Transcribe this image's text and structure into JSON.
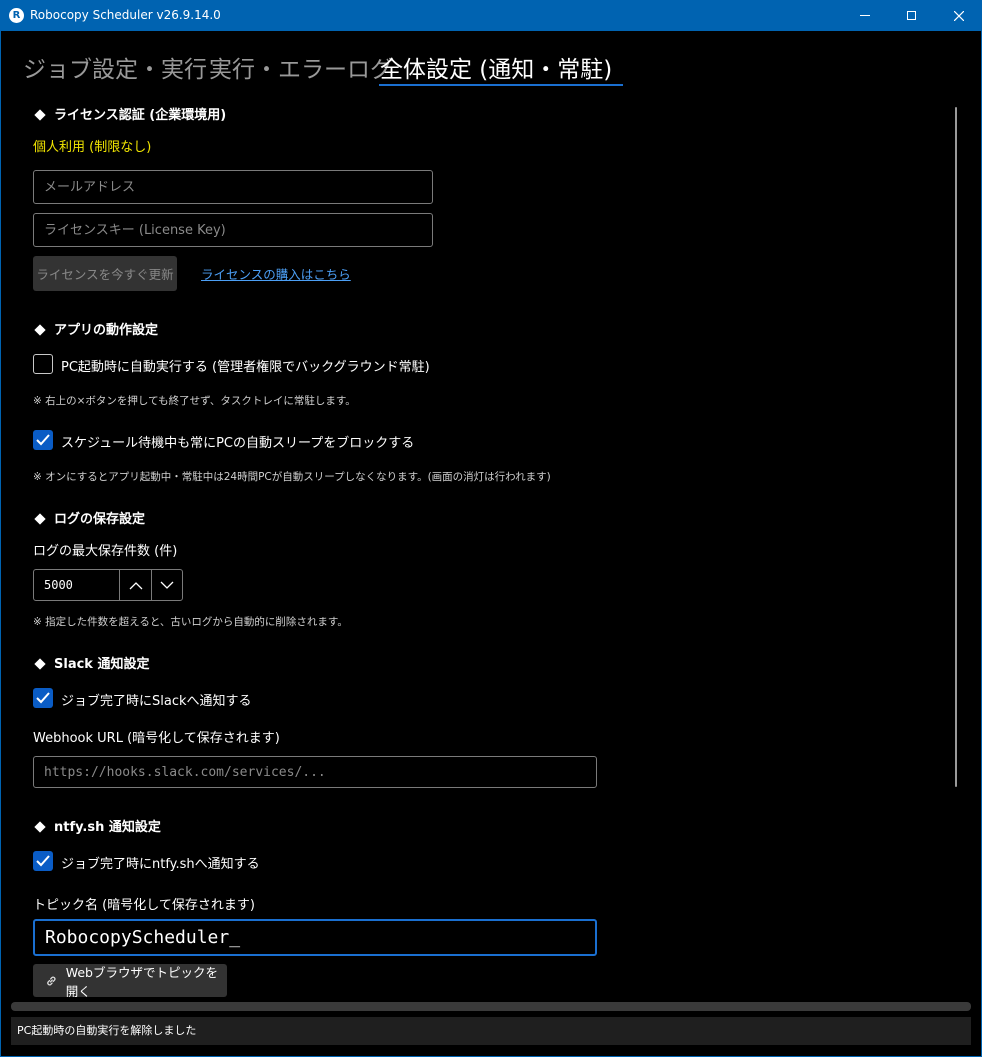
{
  "window": {
    "title": "Robocopy Scheduler v26.9.14.0"
  },
  "tabs": [
    {
      "label": "ジョブ設定・実行"
    },
    {
      "label": "実行・エラーログ"
    },
    {
      "label": "全体設定 (通知・常駐)"
    }
  ],
  "license": {
    "heading": "ライセンス認証 (企業環境用)",
    "status": "個人利用 (制限なし)",
    "email_placeholder": "メールアドレス",
    "key_placeholder": "ライセンスキー (License Key)",
    "update_button": "ライセンスを今すぐ更新",
    "purchase_link": "ライセンスの購入はこちら"
  },
  "app_behavior": {
    "heading": "アプリの動作設定",
    "autostart_label": "PC起動時に自動実行する (管理者権限でバックグラウンド常駐)",
    "autostart_checked": false,
    "autostart_note": "※ 右上の×ボタンを押しても終了せず、タスクトレイに常駐します。",
    "block_sleep_label": "スケジュール待機中も常にPCの自動スリープをブロックする",
    "block_sleep_checked": true,
    "block_sleep_note": "※ オンにするとアプリ起動中・常駐中は24時間PCが自動スリープしなくなります。(画面の消灯は行われます)"
  },
  "log": {
    "heading": "ログの保存設定",
    "max_label": "ログの最大保存件数 (件)",
    "max_value": "5000",
    "note": "※ 指定した件数を超えると、古いログから自動的に削除されます。"
  },
  "slack": {
    "heading": "Slack 通知設定",
    "notify_label": "ジョブ完了時にSlackへ通知する",
    "notify_checked": true,
    "webhook_label": "Webhook URL (暗号化して保存されます)",
    "webhook_placeholder": "https://hooks.slack.com/services/..."
  },
  "ntfy": {
    "heading": "ntfy.sh 通知設定",
    "notify_label": "ジョブ完了時にntfy.shへ通知する",
    "notify_checked": true,
    "topic_label": "トピック名 (暗号化して保存されます)",
    "topic_value": "RobocopyScheduler_",
    "open_button": "Webブラウザでトピックを開く"
  },
  "statusbar": {
    "message": "PC起動時の自動実行を解除しました"
  },
  "colors": {
    "accent": "#0063b1",
    "highlight": "#1a6fd0",
    "license_status": "#f2e600",
    "link": "#4c9ff5"
  }
}
